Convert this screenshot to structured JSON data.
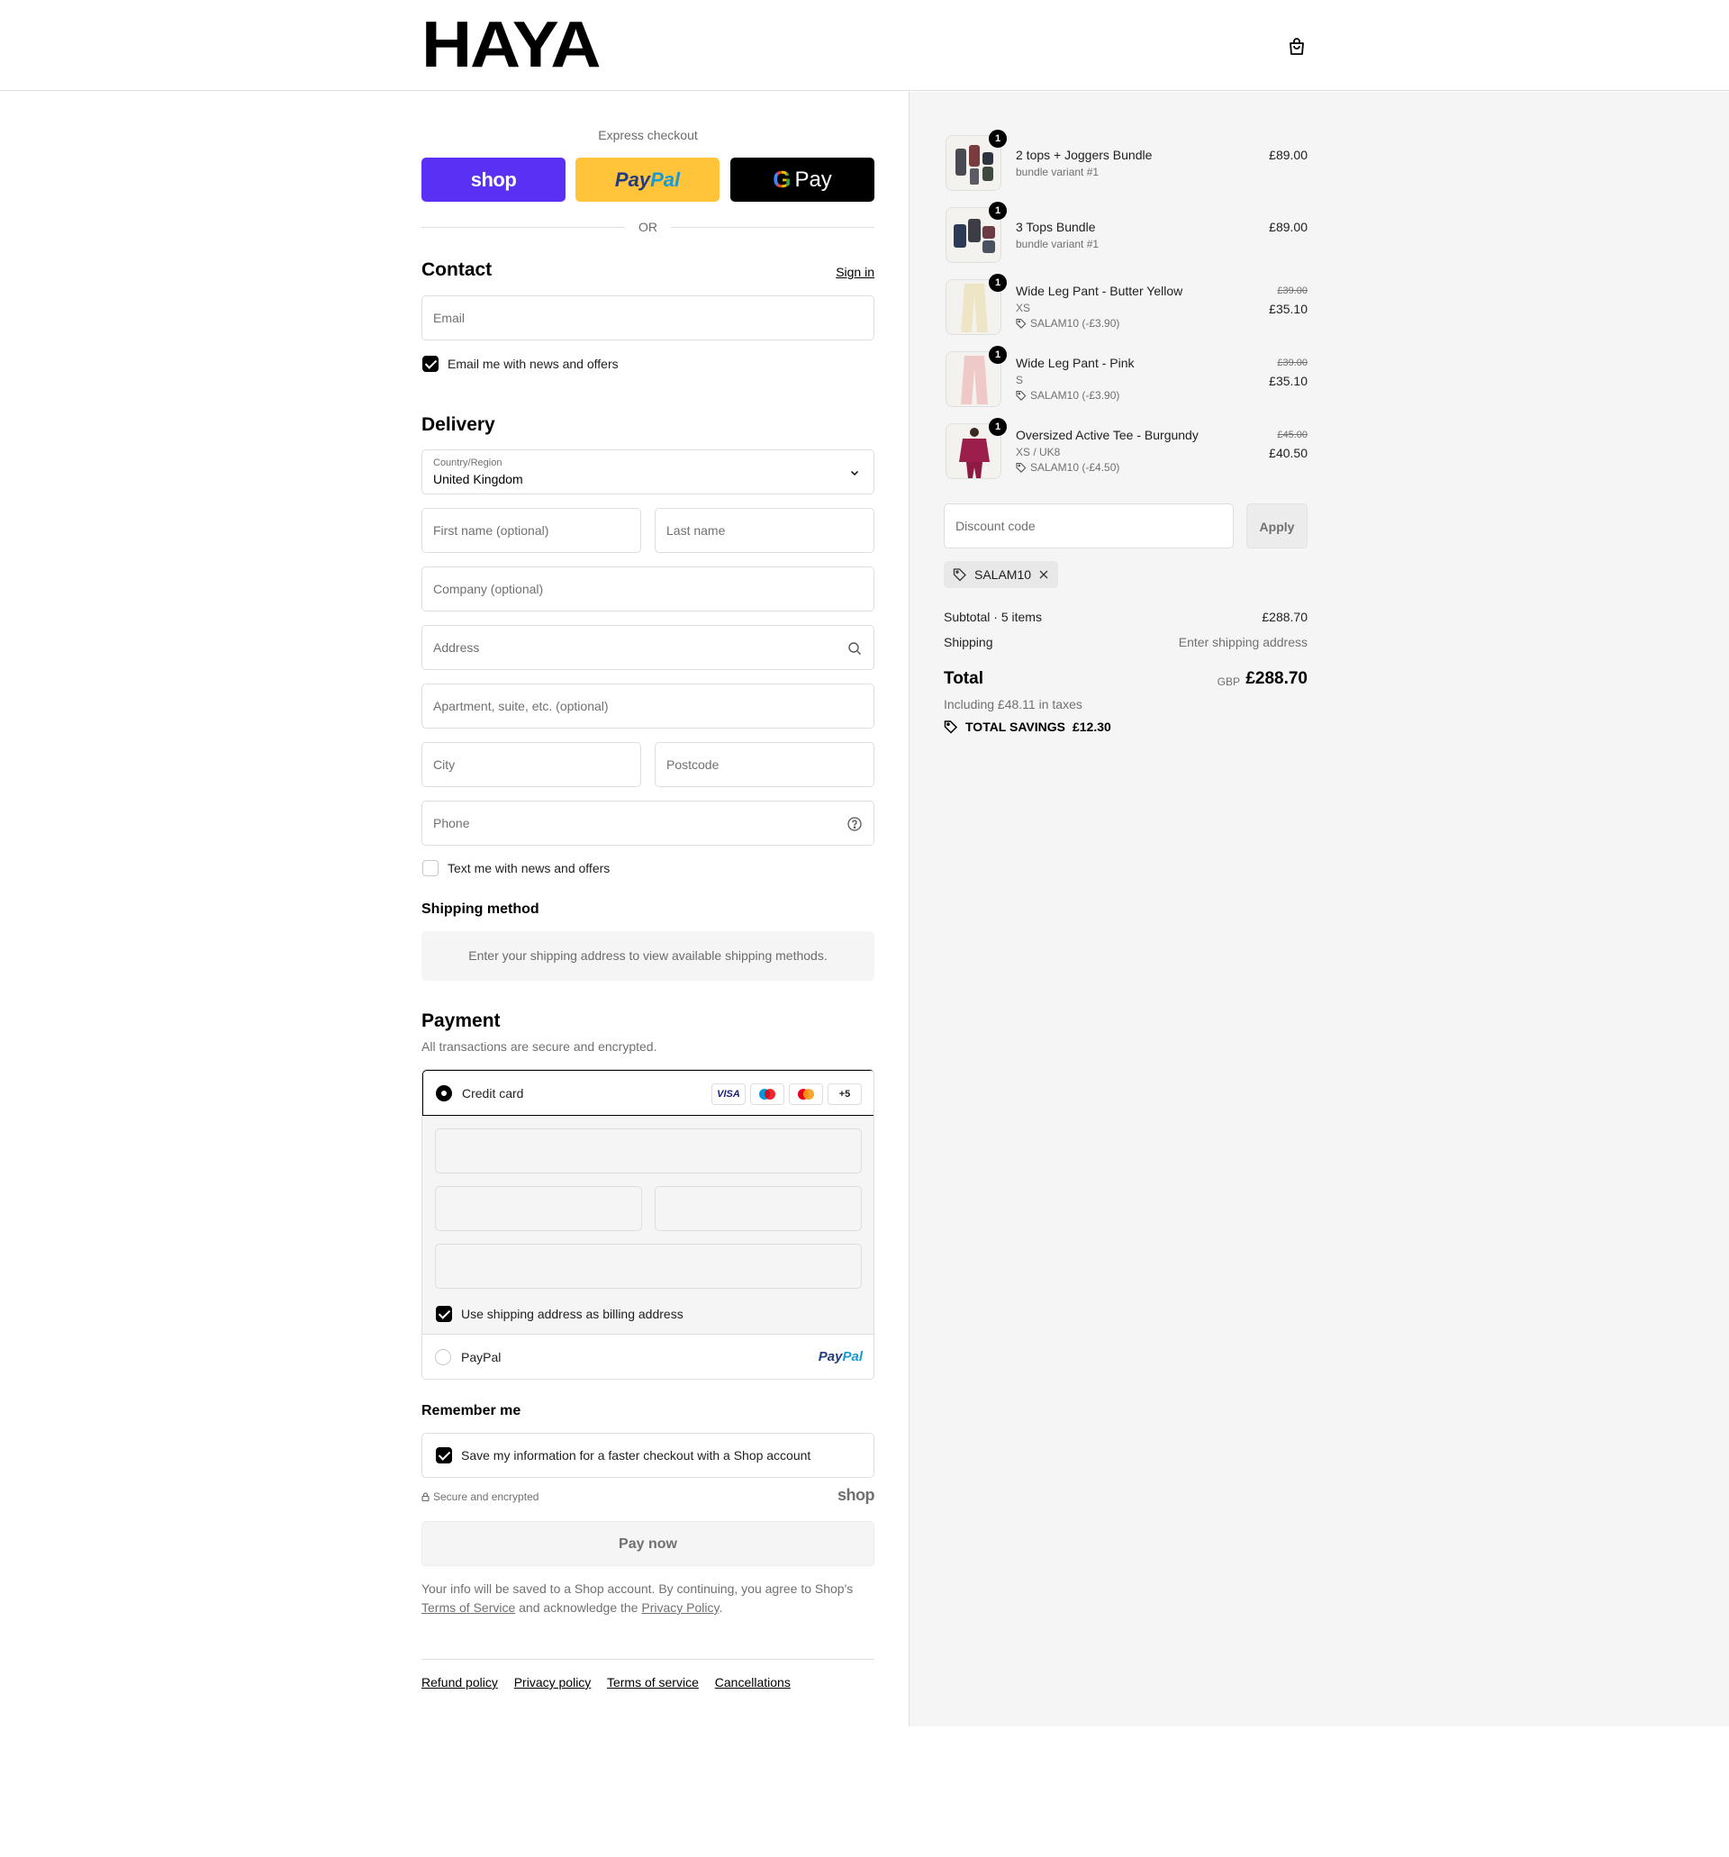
{
  "brand": {
    "logo_text": "HAYA"
  },
  "express": {
    "label": "Express checkout",
    "shop_label": "shop",
    "paypal_a": "Pay",
    "paypal_b": "Pal",
    "gpay_g": "G",
    "gpay_label": "Pay",
    "or_label": "OR"
  },
  "contact": {
    "heading": "Contact",
    "sign_in": "Sign in",
    "email_placeholder": "Email",
    "news_label": "Email me with news and offers",
    "news_checked": true
  },
  "delivery": {
    "heading": "Delivery",
    "country_label": "Country/Region",
    "country_value": "United Kingdom",
    "first_name_placeholder": "First name (optional)",
    "last_name_placeholder": "Last name",
    "company_placeholder": "Company (optional)",
    "address_placeholder": "Address",
    "apartment_placeholder": "Apartment, suite, etc. (optional)",
    "city_placeholder": "City",
    "postcode_placeholder": "Postcode",
    "phone_placeholder": "Phone",
    "text_label": "Text me with news and offers",
    "text_checked": false
  },
  "shipping": {
    "heading": "Shipping method",
    "message": "Enter your shipping address to view available shipping methods."
  },
  "payment": {
    "heading": "Payment",
    "subtitle": "All transactions are secure and encrypted.",
    "credit_card_label": "Credit card",
    "card_icons": [
      "VISA",
      "maestro-icon",
      "mastercard-icon",
      "+5"
    ],
    "billing_label": "Use shipping address as billing address",
    "billing_checked": true,
    "paypal_label": "PayPal",
    "paypal_logo_a": "Pay",
    "paypal_logo_b": "Pal"
  },
  "remember": {
    "heading": "Remember me",
    "save_label": "Save my information for a faster checkout with a Shop account",
    "save_checked": true,
    "secure_label": "Secure and encrypted",
    "shop_logo": "shop"
  },
  "pay_now": "Pay now",
  "legal": {
    "text_1": "Your info will be saved to a Shop account. By continuing, you agree to Shop's",
    "terms_link": "Terms of Service",
    "text_2": "and acknowledge the",
    "privacy_link": "Privacy Policy",
    "text_3": "."
  },
  "footer": {
    "links": [
      "Refund policy",
      "Privacy policy",
      "Terms of service",
      "Cancellations"
    ]
  },
  "summary": {
    "items": [
      {
        "qty": "1",
        "name": "2 tops + Joggers Bundle",
        "variant": "bundle variant #1",
        "price": "£89.00"
      },
      {
        "qty": "1",
        "name": "3 Tops Bundle",
        "variant": "bundle variant #1",
        "price": "£89.00"
      },
      {
        "qty": "1",
        "name": "Wide Leg Pant - Butter Yellow",
        "variant": "XS",
        "discount": "SALAM10 (-£3.90)",
        "old_price": "£39.00",
        "price": "£35.10"
      },
      {
        "qty": "1",
        "name": "Wide Leg Pant - Pink",
        "variant": "S",
        "discount": "SALAM10 (-£3.90)",
        "old_price": "£39.00",
        "price": "£35.10"
      },
      {
        "qty": "1",
        "name": "Oversized Active Tee - Burgundy",
        "variant": "XS / UK8",
        "discount": "SALAM10 (-£4.50)",
        "old_price": "£45.00",
        "price": "£40.50"
      }
    ],
    "discount_placeholder": "Discount code",
    "apply_label": "Apply",
    "chip_code": "SALAM10",
    "subtotal_label": "Subtotal · 5 items",
    "subtotal_value": "£288.70",
    "shipping_label": "Shipping",
    "shipping_value": "Enter shipping address",
    "total_label": "Total",
    "currency": "GBP",
    "total_value": "£288.70",
    "taxes": "Including £48.11 in taxes",
    "savings_label": "TOTAL SAVINGS",
    "savings_value": "£12.30"
  },
  "colors": {
    "shop_purple": "#5a31f4",
    "paypal_yellow": "#ffc439",
    "panel_grey": "#f5f5f5"
  }
}
